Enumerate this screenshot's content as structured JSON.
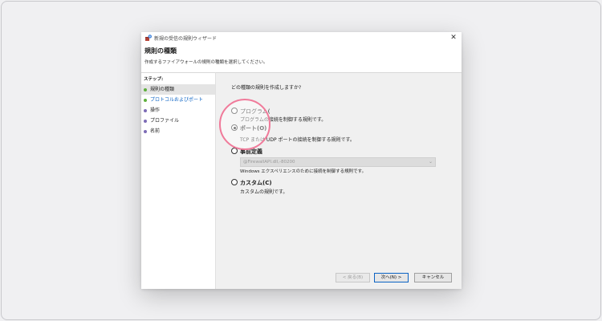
{
  "window": {
    "title": "新規の受信の規則ウィザード",
    "close_glyph": "✕"
  },
  "header": {
    "title": "規則の種類",
    "subtitle": "作成するファイアウォールの規則の種類を選択してください。"
  },
  "sidebar": {
    "steps_label": "ステップ:",
    "items": [
      {
        "label": "規則の種類",
        "dot_color": "#5faf3e"
      },
      {
        "label": "プロトコルおよびポート",
        "dot_color": "#5faf3e"
      },
      {
        "label": "操作",
        "dot_color": "#7d6cb6"
      },
      {
        "label": "プロファイル",
        "dot_color": "#7d6cb6"
      },
      {
        "label": "名前",
        "dot_color": "#7d6cb6"
      }
    ]
  },
  "main": {
    "question": "どの種類の規則を作成しますか?",
    "options": [
      {
        "label": "プログラム(",
        "description": "プログラムの接続を制御する規則です。",
        "checked": false
      },
      {
        "label": "ポート(O)",
        "description": "TCP または UDP ポートの接続を制御する規則です。",
        "checked": true
      },
      {
        "label": "事前定義",
        "select_value": "@FirewallAPI.dll,-80200",
        "description": "Windows エクスペリエンスのために接続を制御する規則です。",
        "checked": false
      },
      {
        "label": "カスタム(C)",
        "description": "カスタムの規則です。",
        "checked": false
      }
    ]
  },
  "buttons": {
    "back": "< 戻る(B)",
    "next": "次へ(N) >",
    "cancel": "キャンセル"
  },
  "colors": {
    "highlight_ring": "#f07a9a",
    "link": "#0b63c4"
  }
}
